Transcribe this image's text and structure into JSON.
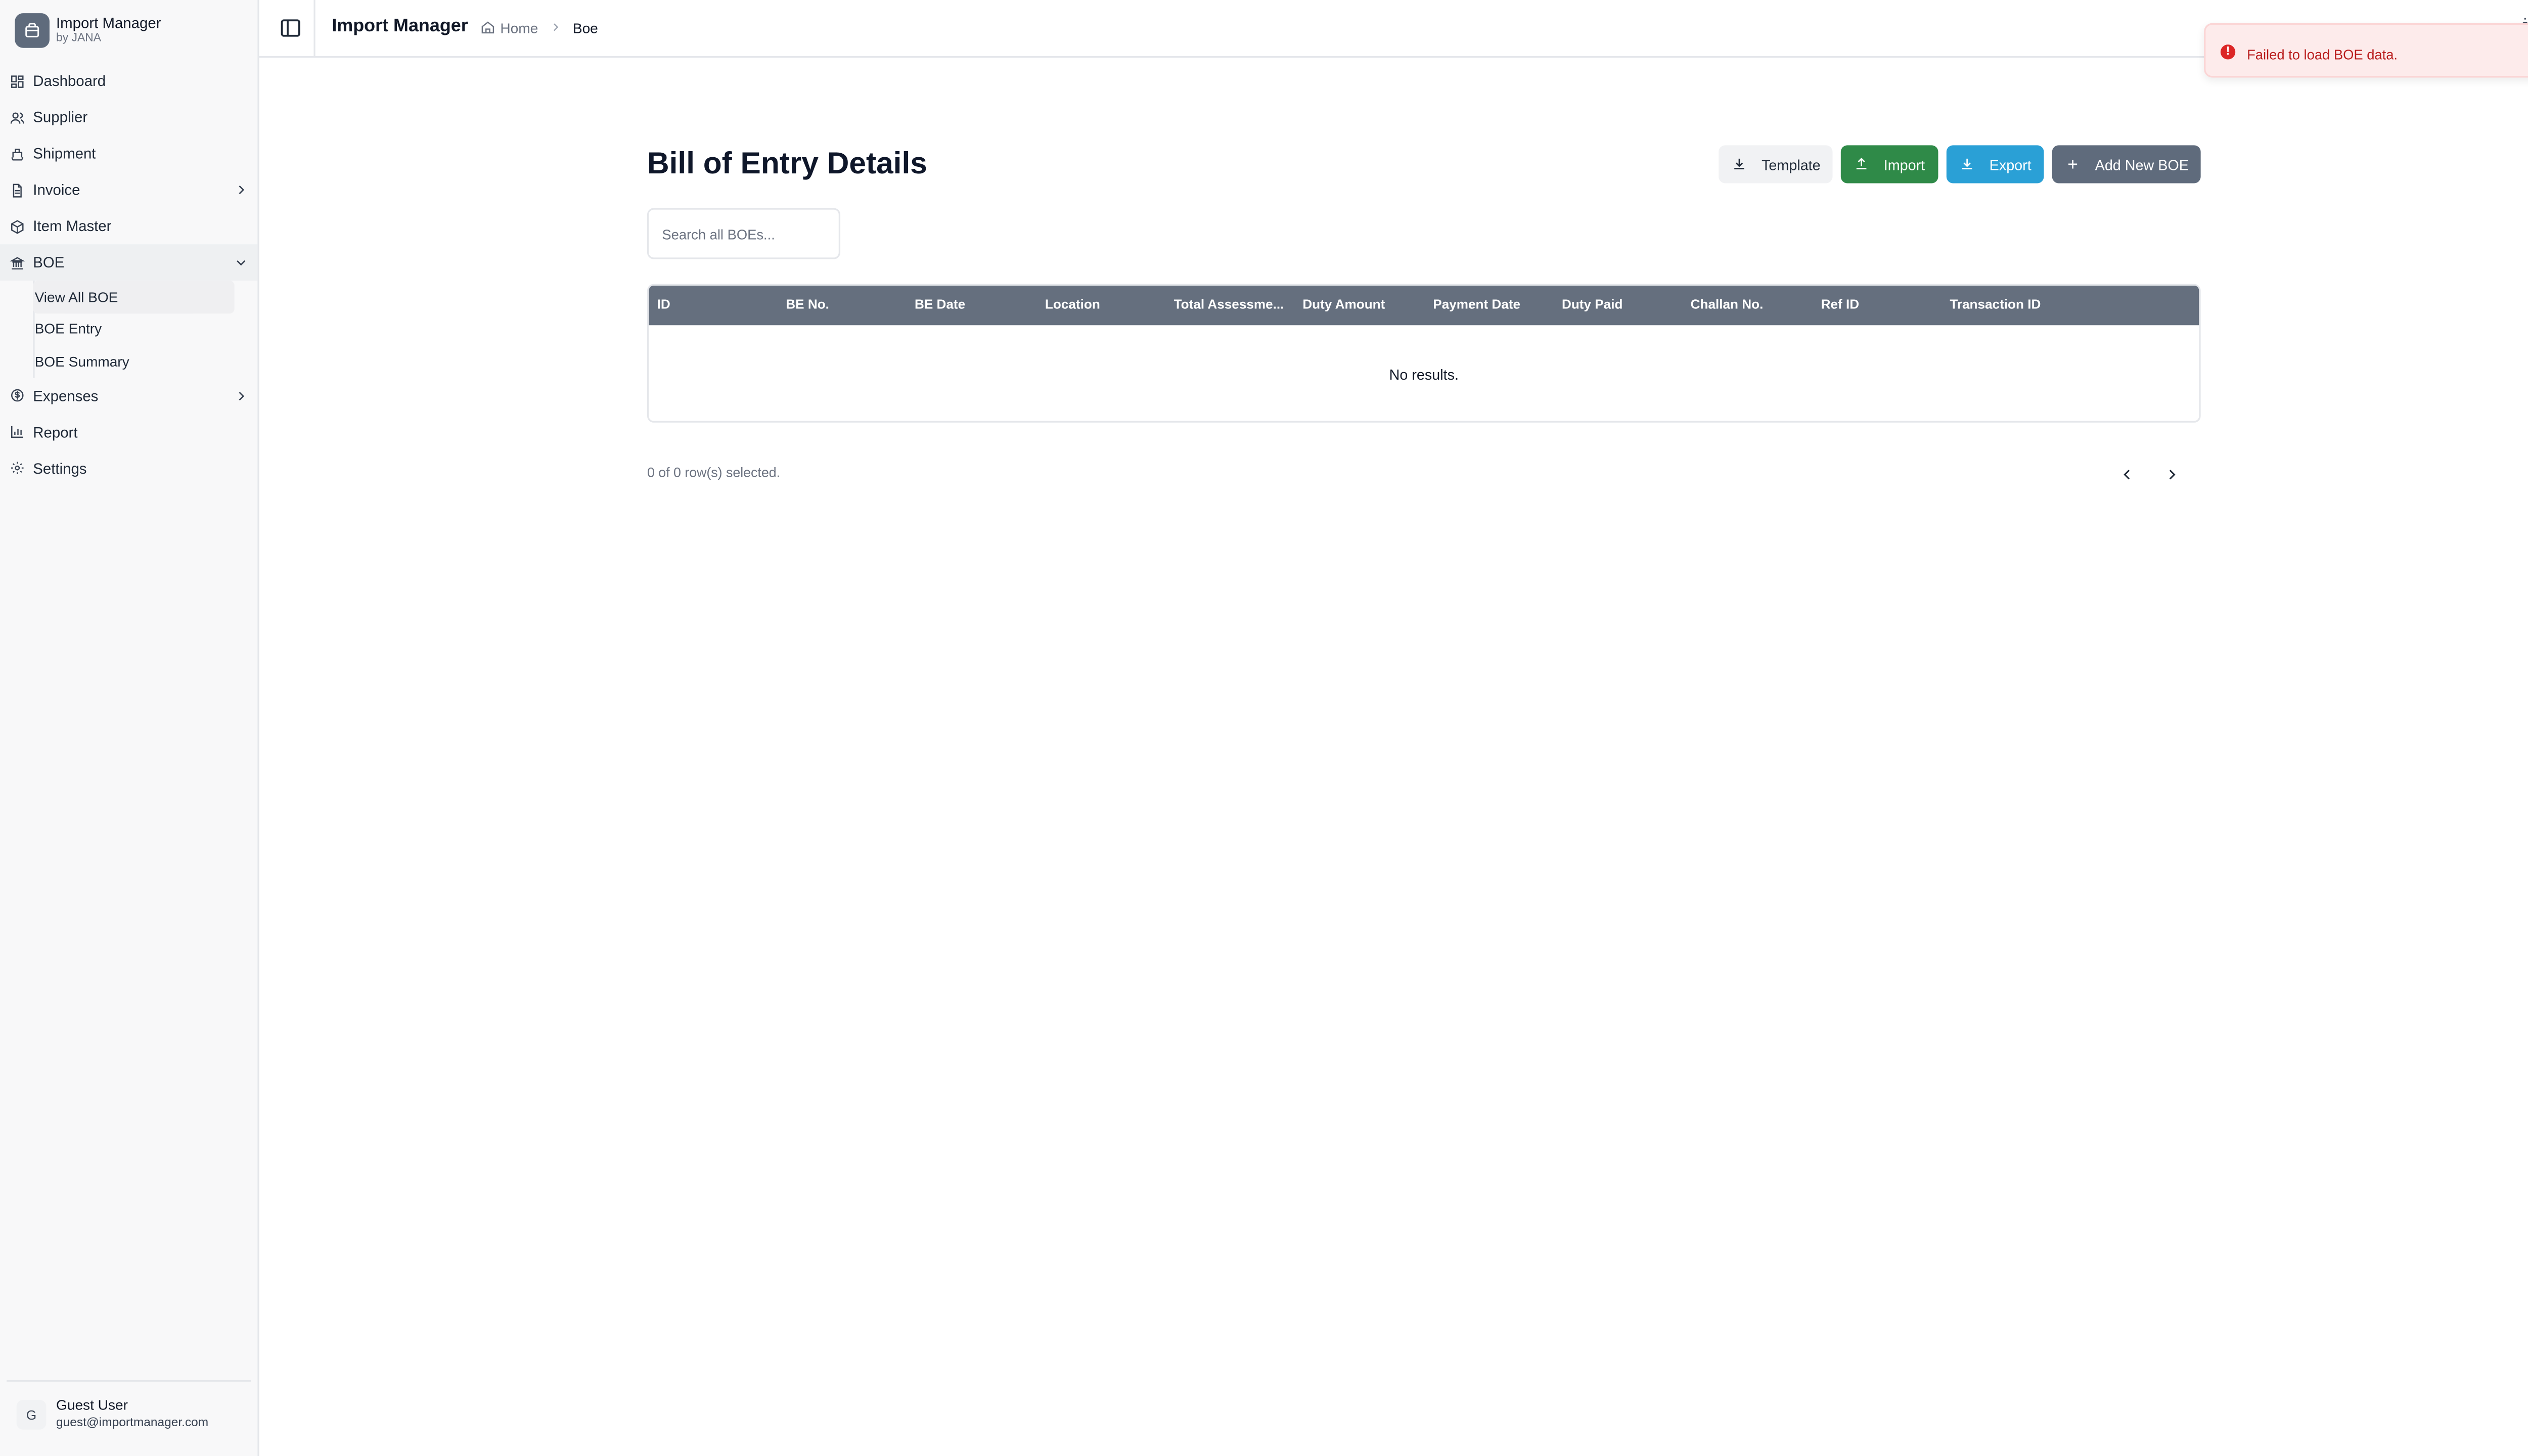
{
  "app": {
    "name": "Import Manager",
    "sub": "by JANA"
  },
  "sidebar": {
    "items": [
      {
        "label": "Dashboard"
      },
      {
        "label": "Supplier"
      },
      {
        "label": "Shipment"
      },
      {
        "label": "Invoice"
      },
      {
        "label": "Item Master"
      },
      {
        "label": "BOE"
      },
      {
        "label": "Expenses"
      },
      {
        "label": "Report"
      },
      {
        "label": "Settings"
      }
    ],
    "boe_sub": [
      {
        "label": "View All BOE"
      },
      {
        "label": "BOE Entry"
      },
      {
        "label": "BOE Summary"
      }
    ]
  },
  "user": {
    "initial": "G",
    "name": "Guest User",
    "email": "guest@importmanager.com"
  },
  "header": {
    "title": "Import Manager",
    "home": "Home",
    "current": "Boe"
  },
  "main": {
    "title": "Bill of Entry Details",
    "buttons": {
      "template": "Template",
      "import": "Import",
      "export": "Export",
      "add": "Add New BOE"
    },
    "search_placeholder": "Search all BOEs...",
    "columns": [
      "ID",
      "BE No.",
      "BE Date",
      "Location",
      "Total Assessme...",
      "Duty Amount",
      "Payment Date",
      "Duty Paid",
      "Challan No.",
      "Ref ID",
      "Transaction ID"
    ],
    "empty": "No results.",
    "selection": "0 of 0 row(s) selected."
  },
  "toast": {
    "message": "Failed to load BOE data."
  },
  "colors": {
    "import": "#2f8a48",
    "export": "#2aa0d6",
    "add": "#5f6b7c",
    "error": "#dc2626"
  }
}
